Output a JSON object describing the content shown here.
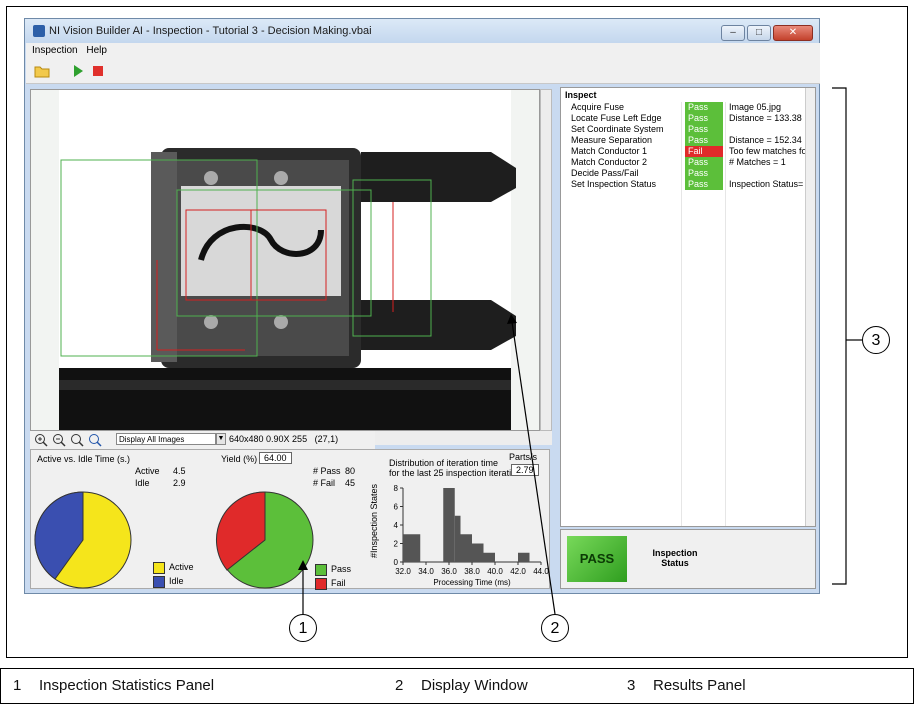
{
  "window": {
    "title": "NI Vision Builder AI - Inspection - Tutorial 3 - Decision Making.vbai",
    "buttons": {
      "minimize": "–",
      "maximize": "□",
      "close": "✕"
    }
  },
  "menu": [
    "Inspection",
    "Help"
  ],
  "toolbar": {
    "icons": [
      "open-folder-icon",
      "run-icon",
      "stop-icon"
    ],
    "colors": {
      "run": "#2ea02e",
      "stop": "#e0302c"
    }
  },
  "display": {
    "select_value": "Display All Images",
    "image_info": "640x480 0.90X 255",
    "coords": "(27,1)"
  },
  "stats": {
    "active_idle": {
      "title": "Active vs. Idle Time (s.)",
      "active_label": "Active",
      "active_value": "4.5",
      "idle_label": "Idle",
      "idle_value": "2.9",
      "legend_active": "Active",
      "legend_idle": "Idle",
      "active_color": "#f5e51b",
      "idle_color": "#3a4fb0"
    },
    "yield": {
      "label": "Yield (%)",
      "value": "64.00",
      "pass_label": "# Pass",
      "pass_value": "80",
      "fail_label": "# Fail",
      "fail_value": "45",
      "legend_pass": "Pass",
      "legend_fail": "Fail",
      "pass_color": "#5cbf3a",
      "fail_color": "#e02a2a"
    },
    "distribution": {
      "title_line1": "Distribution of iteration time",
      "title_line2": "for the last 25 inspection iterations",
      "parts_label": "Parts/s",
      "parts_value": "2.79",
      "ylabel": "#Inspection States",
      "xlabel": "Processing Time (ms)"
    }
  },
  "chart_data": {
    "type": "bar",
    "title": "Distribution of iteration time for the last 25 inspection iterations",
    "xlabel": "Processing Time (ms)",
    "ylabel": "#Inspection States",
    "x_ticks": [
      "32.0",
      "34.0",
      "36.0",
      "38.0",
      "40.0",
      "42.0",
      "44.0"
    ],
    "y_ticks": [
      "0",
      "2",
      "4",
      "6",
      "8"
    ],
    "xlim": [
      32,
      44
    ],
    "ylim": [
      0,
      8
    ],
    "bins": [
      {
        "start": 32.0,
        "end": 33.5,
        "value": 3
      },
      {
        "start": 35.5,
        "end": 36.5,
        "value": 8
      },
      {
        "start": 36.5,
        "end": 37.0,
        "value": 5
      },
      {
        "start": 37.0,
        "end": 38.0,
        "value": 3
      },
      {
        "start": 38.0,
        "end": 39.0,
        "value": 2
      },
      {
        "start": 39.0,
        "end": 40.0,
        "value": 1
      },
      {
        "start": 42.0,
        "end": 43.0,
        "value": 1
      }
    ]
  },
  "results": {
    "header": "Inspect",
    "rows": [
      {
        "name": "Acquire Fuse",
        "status": "Pass",
        "value": "Image 05.jpg"
      },
      {
        "name": "Locate Fuse Left Edge",
        "status": "Pass",
        "value": "Distance = 133.38"
      },
      {
        "name": "Set Coordinate System",
        "status": "Pass",
        "value": ""
      },
      {
        "name": "Measure Separation",
        "status": "Pass",
        "value": "Distance = 152.34"
      },
      {
        "name": "Match Conductor 1",
        "status": "Fail",
        "value": "Too few matches fo"
      },
      {
        "name": "Match Conductor 2",
        "status": "Pass",
        "value": "# Matches = 1"
      },
      {
        "name": "Decide Pass/Fail",
        "status": "Pass",
        "value": ""
      },
      {
        "name": "Set Inspection Status",
        "status": "Pass",
        "value": "Inspection Status="
      }
    ],
    "pass_color": "#5cbf3a",
    "fail_color": "#e02a2a"
  },
  "inspection_status": {
    "value": "PASS",
    "label_line1": "Inspection",
    "label_line2": "Status"
  },
  "callouts": [
    {
      "num": "1",
      "label": "Inspection Statistics Panel"
    },
    {
      "num": "2",
      "label": "Display Window"
    },
    {
      "num": "3",
      "label": "Results Panel"
    }
  ]
}
